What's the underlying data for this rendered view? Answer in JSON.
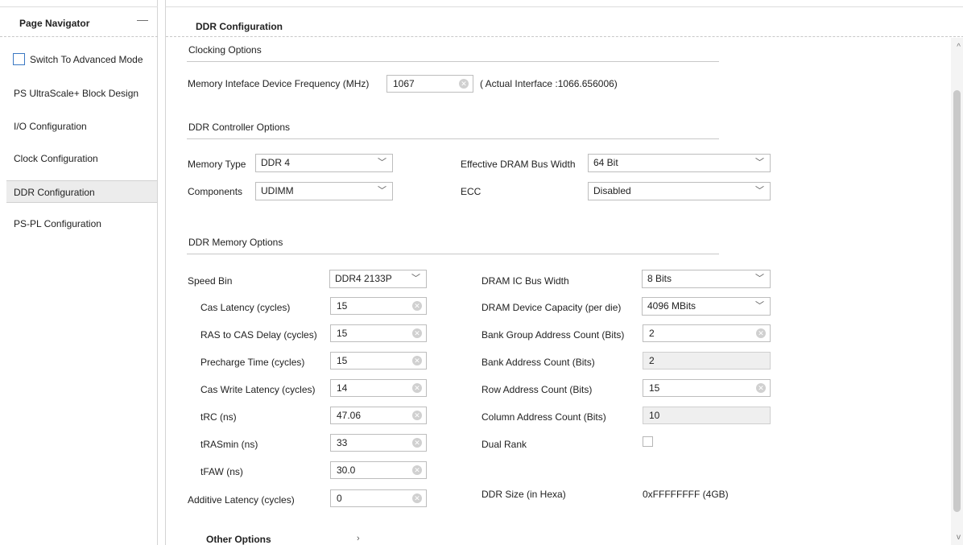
{
  "navigator": {
    "title": "Page Navigator",
    "minimize": "—",
    "advanced_mode": "Switch To Advanced Mode",
    "items": [
      "PS UltraScale+ Block Design",
      "I/O Configuration",
      "Clock Configuration",
      "DDR Configuration",
      "PS-PL Configuration"
    ],
    "active": "DDR Configuration"
  },
  "content": {
    "title": "DDR Configuration",
    "clocking": {
      "title": "Clocking Options",
      "freq_label": "Memory Inteface Device Frequency (MHz)",
      "freq_value": "1067",
      "actual": "( Actual Interface :1066.656006)"
    },
    "controller": {
      "title": "DDR Controller Options",
      "memory_type_label": "Memory Type",
      "memory_type": "DDR 4",
      "components_label": "Components",
      "components": "UDIMM",
      "bus_width_label": "Effective DRAM Bus Width",
      "bus_width": "64 Bit",
      "ecc_label": "ECC",
      "ecc": "Disabled"
    },
    "memory": {
      "title": "DDR Memory Options",
      "speed_bin_label": "Speed Bin",
      "speed_bin": "DDR4 2133P",
      "cas_latency_label": "Cas Latency (cycles)",
      "cas_latency": "15",
      "ras_cas_label": "RAS to CAS Delay (cycles)",
      "ras_cas": "15",
      "precharge_label": "Precharge Time (cycles)",
      "precharge": "15",
      "cas_write_label": "Cas Write Latency (cycles)",
      "cas_write": "14",
      "trc_label": "tRC (ns)",
      "trc": "47.06",
      "tras_label": "tRASmin (ns)",
      "tras": "33",
      "tfaw_label": "tFAW (ns)",
      "tfaw": "30.0",
      "additive_label": "Additive Latency (cycles)",
      "additive": "0",
      "ic_bus_label": "DRAM IC Bus Width",
      "ic_bus": "8 Bits",
      "capacity_label": "DRAM Device Capacity (per die)",
      "capacity": "4096 MBits",
      "bank_group_label": "Bank Group Address Count (Bits)",
      "bank_group": "2",
      "bank_addr_label": "Bank Address Count (Bits)",
      "bank_addr": "2",
      "row_addr_label": "Row Address Count (Bits)",
      "row_addr": "15",
      "col_addr_label": "Column Address Count (Bits)",
      "col_addr": "10",
      "dual_rank_label": "Dual Rank",
      "size_label": "DDR Size (in Hexa)",
      "size": "0xFFFFFFFF (4GB)"
    },
    "other_options": "Other Options"
  }
}
